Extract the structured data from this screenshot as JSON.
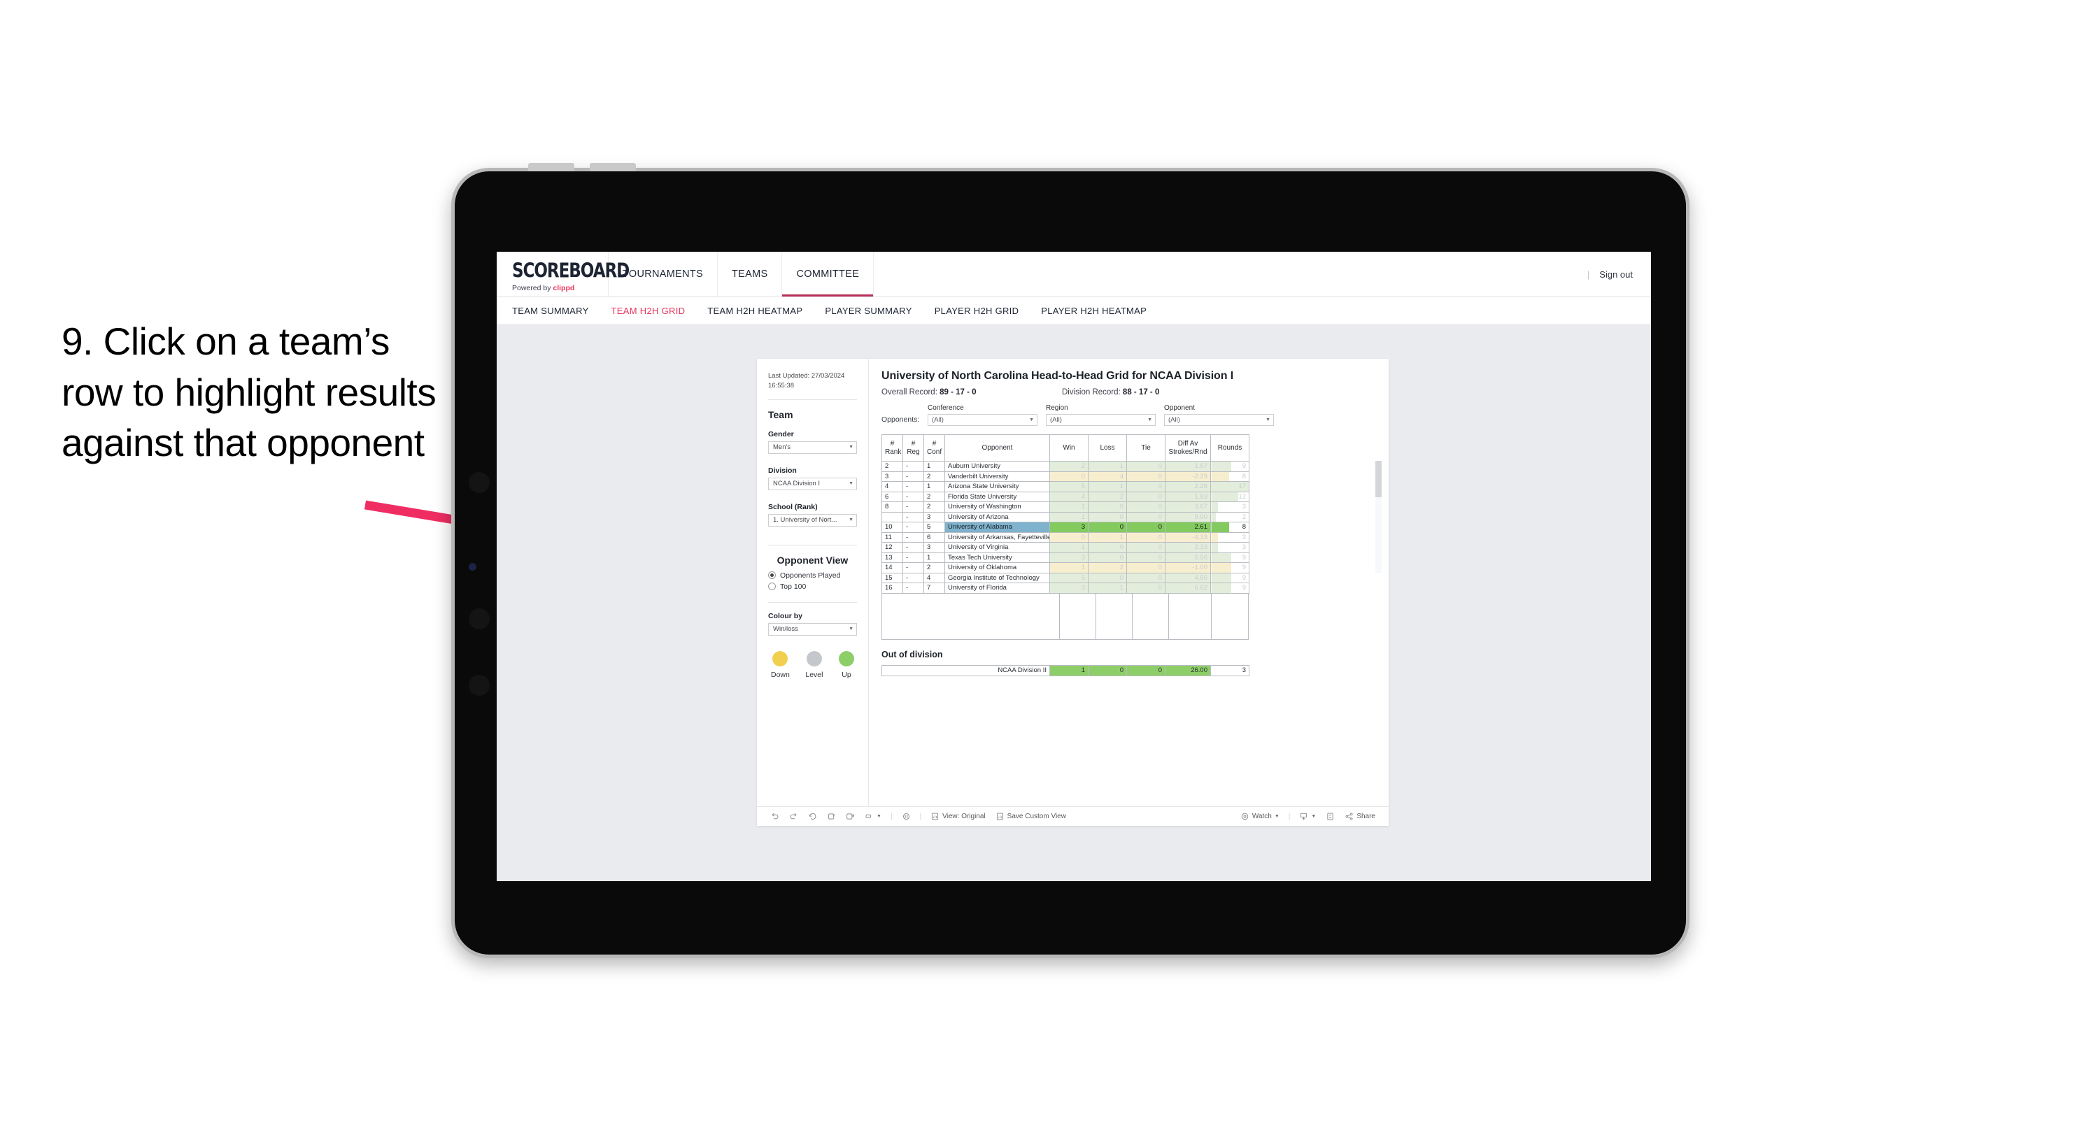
{
  "annotation": {
    "text": "9. Click on a team’s row to highlight results against that opponent",
    "arrow_color": "#ef2d62"
  },
  "app": {
    "logo_main": "SCOREBOARD",
    "logo_sub_prefix": "Powered by ",
    "logo_sub_brand": "clippd",
    "nav": [
      {
        "label": "TOURNAMENTS",
        "active": false
      },
      {
        "label": "TEAMS",
        "active": false
      },
      {
        "label": "COMMITTEE",
        "active": true
      }
    ],
    "sign_out": "Sign out",
    "divider": "|",
    "subnav": [
      {
        "label": "TEAM SUMMARY",
        "active": false
      },
      {
        "label": "TEAM H2H GRID",
        "active": true
      },
      {
        "label": "TEAM H2H HEATMAP",
        "active": false
      },
      {
        "label": "PLAYER SUMMARY",
        "active": false
      },
      {
        "label": "PLAYER H2H GRID",
        "active": false
      },
      {
        "label": "PLAYER H2H HEATMAP",
        "active": false
      }
    ],
    "accent": "#e8335c"
  },
  "sidebar": {
    "last_updated": "Last Updated: 27/03/2024 16:55:38",
    "team_heading": "Team",
    "gender_label": "Gender",
    "gender_value": "Men’s",
    "division_label": "Division",
    "division_value": "NCAA Division I",
    "school_label": "School (Rank)",
    "school_value": "1. University of Nort...",
    "opponent_view_heading": "Opponent View",
    "opponent_view_options": [
      {
        "label": "Opponents Played",
        "selected": true
      },
      {
        "label": "Top 100",
        "selected": false
      }
    ],
    "colour_by_label": "Colour by",
    "colour_by_value": "Win/loss",
    "legend": [
      {
        "label": "Down",
        "color": "#f2d04f"
      },
      {
        "label": "Level",
        "color": "#c4c7cb"
      },
      {
        "label": "Up",
        "color": "#8ece68"
      }
    ]
  },
  "viz": {
    "title": "University of North Carolina Head-to-Head Grid for NCAA Division I",
    "overall_record_label": "Overall Record: ",
    "overall_record_value": "89 - 17 - 0",
    "division_record_label": "Division Record: ",
    "division_record_value": "88 - 17 - 0",
    "opponents_label": "Opponents:",
    "filters": [
      {
        "label": "Conference",
        "value": "(All)"
      },
      {
        "label": "Region",
        "value": "(All)"
      },
      {
        "label": "Opponent",
        "value": "(All)"
      }
    ],
    "out_of_division_heading": "Out of division",
    "out_of_division_row": {
      "label": "NCAA Division II",
      "win": "1",
      "loss": "0",
      "tie": "0",
      "diff": "26.00",
      "rounds": "3"
    }
  },
  "chart_data": {
    "type": "table",
    "title": "University of North Carolina Head-to-Head Grid for NCAA Division I",
    "columns": [
      "# Rank",
      "# Reg",
      "# Conf",
      "Opponent",
      "Win",
      "Loss",
      "Tie",
      "Diff Av Strokes/Rnd",
      "Rounds"
    ],
    "column_lines": [
      [
        "#",
        "Rank"
      ],
      [
        "#",
        "Reg"
      ],
      [
        "#",
        "Conf"
      ],
      [
        "Opponent"
      ],
      [
        "Win"
      ],
      [
        "Loss"
      ],
      [
        "Tie"
      ],
      [
        "Diff Av",
        "Strokes/Rnd"
      ],
      [
        "Rounds"
      ]
    ],
    "rows": [
      {
        "rank": "2",
        "reg": "-",
        "conf": "1",
        "opponent": "Auburn University",
        "win": "2",
        "loss": "1",
        "tie": "0",
        "diff": "1.67",
        "rounds": "9",
        "tone": "green",
        "selected": false
      },
      {
        "rank": "3",
        "reg": "-",
        "conf": "2",
        "opponent": "Vanderbilt University",
        "win": "0",
        "loss": "4",
        "tie": "0",
        "diff": "-2.29",
        "rounds": "8",
        "tone": "amber",
        "selected": false
      },
      {
        "rank": "4",
        "reg": "-",
        "conf": "1",
        "opponent": "Arizona State University",
        "win": "5",
        "loss": "1",
        "tie": "0",
        "diff": "2.28",
        "rounds": "17",
        "tone": "green",
        "selected": false
      },
      {
        "rank": "6",
        "reg": "-",
        "conf": "2",
        "opponent": "Florida State University",
        "win": "4",
        "loss": "2",
        "tie": "0",
        "diff": "1.83",
        "rounds": "12",
        "tone": "green",
        "selected": false
      },
      {
        "rank": "8",
        "reg": "-",
        "conf": "2",
        "opponent": "University of Washington",
        "win": "1",
        "loss": "0",
        "tie": "0",
        "diff": "3.67",
        "rounds": "3",
        "tone": "green",
        "selected": false
      },
      {
        "rank": "",
        "reg": "-",
        "conf": "3",
        "opponent": "University of Arizona",
        "win": "1",
        "loss": "0",
        "tie": "0",
        "diff": "9.00",
        "rounds": "2",
        "tone": "green",
        "selected": false
      },
      {
        "rank": "10",
        "reg": "-",
        "conf": "5",
        "opponent": "University of Alabama",
        "win": "3",
        "loss": "0",
        "tie": "0",
        "diff": "2.61",
        "rounds": "8",
        "tone": "green",
        "selected": true
      },
      {
        "rank": "11",
        "reg": "-",
        "conf": "6",
        "opponent": "University of Arkansas, Fayetteville",
        "win": "0",
        "loss": "1",
        "tie": "0",
        "diff": "-4.33",
        "rounds": "3",
        "tone": "amber",
        "selected": false
      },
      {
        "rank": "12",
        "reg": "-",
        "conf": "3",
        "opponent": "University of Virginia",
        "win": "1",
        "loss": "0",
        "tie": "0",
        "diff": "2.33",
        "rounds": "3",
        "tone": "green",
        "selected": false
      },
      {
        "rank": "13",
        "reg": "-",
        "conf": "1",
        "opponent": "Texas Tech University",
        "win": "3",
        "loss": "0",
        "tie": "0",
        "diff": "5.56",
        "rounds": "9",
        "tone": "green",
        "selected": false
      },
      {
        "rank": "14",
        "reg": "-",
        "conf": "2",
        "opponent": "University of Oklahoma",
        "win": "1",
        "loss": "2",
        "tie": "0",
        "diff": "-1.00",
        "rounds": "9",
        "tone": "amber",
        "selected": false
      },
      {
        "rank": "15",
        "reg": "-",
        "conf": "4",
        "opponent": "Georgia Institute of Technology",
        "win": "5",
        "loss": "0",
        "tie": "0",
        "diff": "4.50",
        "rounds": "9",
        "tone": "green",
        "selected": false
      },
      {
        "rank": "16",
        "reg": "-",
        "conf": "7",
        "opponent": "University of Florida",
        "win": "3",
        "loss": "1",
        "tie": "0",
        "diff": "6.62",
        "rounds": "9",
        "tone": "green",
        "selected": false
      }
    ],
    "selected_opponent": "University of Alabama",
    "colors": {
      "green_row": "#e3eddc",
      "amber_row": "#f7eecf",
      "selected_bar": "#83cb5f",
      "selected_label": "#7fb2cd"
    }
  },
  "toolbar": {
    "items": [
      {
        "name": "undo",
        "label": ""
      },
      {
        "name": "redo",
        "label": ""
      },
      {
        "name": "revert",
        "label": ""
      },
      {
        "name": "refresh",
        "label": ""
      },
      {
        "name": "pause",
        "label": ""
      },
      {
        "name": "alerts",
        "label": ""
      },
      {
        "name": "history",
        "label": ""
      },
      {
        "name": "view-original",
        "label": "View: Original"
      },
      {
        "name": "save-custom-view",
        "label": "Save Custom View"
      },
      {
        "name": "watch",
        "label": "Watch"
      },
      {
        "name": "download",
        "label": ""
      },
      {
        "name": "fullscreen",
        "label": ""
      },
      {
        "name": "share",
        "label": "Share"
      }
    ],
    "separator": "|"
  }
}
